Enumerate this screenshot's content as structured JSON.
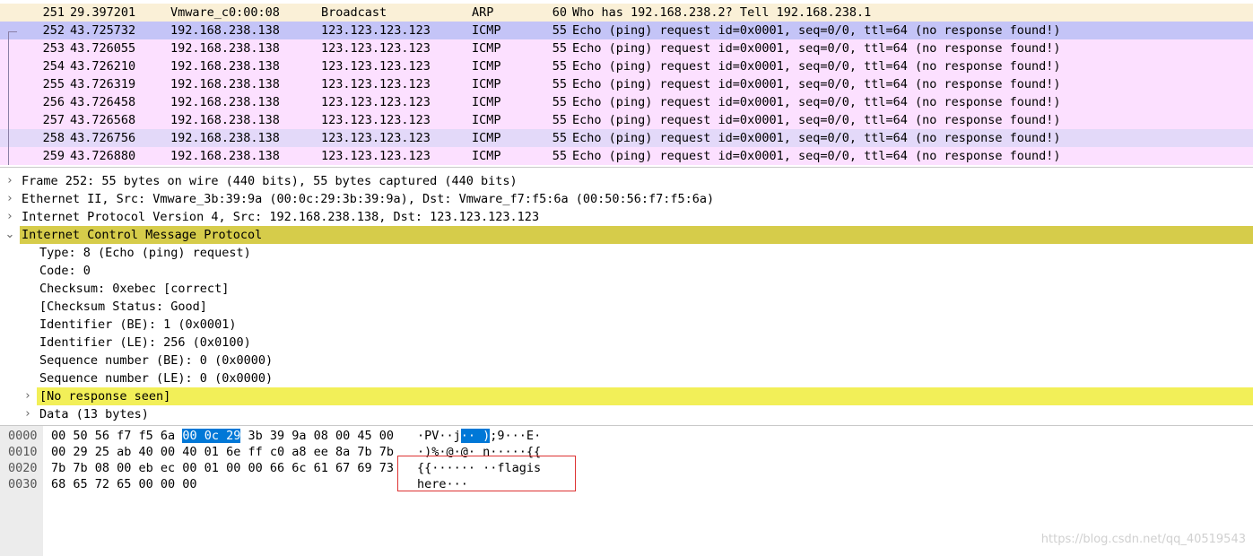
{
  "packets": [
    {
      "no": "251",
      "time": "29.397201",
      "src": "Vmware_c0:00:08",
      "dst": "Broadcast",
      "proto": "ARP",
      "len": "60",
      "info": "Who has 192.168.238.2? Tell 192.168.238.1"
    },
    {
      "no": "252",
      "time": "43.725732",
      "src": "192.168.238.138",
      "dst": "123.123.123.123",
      "proto": "ICMP",
      "len": "55",
      "info": "Echo (ping) request  id=0x0001, seq=0/0, ttl=64 (no response found!)"
    },
    {
      "no": "253",
      "time": "43.726055",
      "src": "192.168.238.138",
      "dst": "123.123.123.123",
      "proto": "ICMP",
      "len": "55",
      "info": "Echo (ping) request  id=0x0001, seq=0/0, ttl=64 (no response found!)"
    },
    {
      "no": "254",
      "time": "43.726210",
      "src": "192.168.238.138",
      "dst": "123.123.123.123",
      "proto": "ICMP",
      "len": "55",
      "info": "Echo (ping) request  id=0x0001, seq=0/0, ttl=64 (no response found!)"
    },
    {
      "no": "255",
      "time": "43.726319",
      "src": "192.168.238.138",
      "dst": "123.123.123.123",
      "proto": "ICMP",
      "len": "55",
      "info": "Echo (ping) request  id=0x0001, seq=0/0, ttl=64 (no response found!)"
    },
    {
      "no": "256",
      "time": "43.726458",
      "src": "192.168.238.138",
      "dst": "123.123.123.123",
      "proto": "ICMP",
      "len": "55",
      "info": "Echo (ping) request  id=0x0001, seq=0/0, ttl=64 (no response found!)"
    },
    {
      "no": "257",
      "time": "43.726568",
      "src": "192.168.238.138",
      "dst": "123.123.123.123",
      "proto": "ICMP",
      "len": "55",
      "info": "Echo (ping) request  id=0x0001, seq=0/0, ttl=64 (no response found!)"
    },
    {
      "no": "258",
      "time": "43.726756",
      "src": "192.168.238.138",
      "dst": "123.123.123.123",
      "proto": "ICMP",
      "len": "55",
      "info": "Echo (ping) request  id=0x0001, seq=0/0, ttl=64 (no response found!)"
    },
    {
      "no": "259",
      "time": "43.726880",
      "src": "192.168.238.138",
      "dst": "123.123.123.123",
      "proto": "ICMP",
      "len": "55",
      "info": "Echo (ping) request  id=0x0001, seq=0/0, ttl=64 (no response found!)"
    }
  ],
  "details": [
    {
      "text": "Frame 252: 55 bytes on wire (440 bits), 55 bytes captured (440 bits)",
      "twisty": ">"
    },
    {
      "text": "Ethernet II, Src: Vmware_3b:39:9a (00:0c:29:3b:39:9a), Dst: Vmware_f7:f5:6a (00:50:56:f7:f5:6a)",
      "twisty": ">"
    },
    {
      "text": "Internet Protocol Version 4, Src: 192.168.238.138, Dst: 123.123.123.123",
      "twisty": ">"
    },
    {
      "text": "Internet Control Message Protocol",
      "twisty": "v"
    },
    {
      "text": "Type: 8 (Echo (ping) request)"
    },
    {
      "text": "Code: 0"
    },
    {
      "text": "Checksum: 0xebec [correct]"
    },
    {
      "text": "[Checksum Status: Good]"
    },
    {
      "text": "Identifier (BE): 1 (0x0001)"
    },
    {
      "text": "Identifier (LE): 256 (0x0100)"
    },
    {
      "text": "Sequence number (BE): 0 (0x0000)"
    },
    {
      "text": "Sequence number (LE): 0 (0x0000)"
    },
    {
      "text": "[No response seen]",
      "twisty": ">"
    },
    {
      "text": "Data (13 bytes)",
      "twisty": ">"
    }
  ],
  "bytes": [
    {
      "offset": "0000",
      "hex_a": "00 50 56 f7 f5 6a ",
      "hex_sel": "00 0c  29",
      "hex_b": " 3b 39 9a 08 00 45 00",
      "ascii_a": "·PV··j",
      "ascii_sel": "·· )",
      "ascii_b": ";9···E·"
    },
    {
      "offset": "0010",
      "hex_a": "00 29 25 ab 40 00 40 01  6e ff c0 a8 ee 8a 7b 7b",
      "hex_sel": "",
      "hex_b": "",
      "ascii_a": "·)%·@·@· n·····{{",
      "ascii_sel": "",
      "ascii_b": ""
    },
    {
      "offset": "0020",
      "hex_a": "7b 7b 08 00 eb ec 00 01  00 00 66 6c 61 67 69 73",
      "hex_sel": "",
      "hex_b": "",
      "ascii_a": "{{······ ··flagis",
      "ascii_sel": "",
      "ascii_b": ""
    },
    {
      "offset": "0030",
      "hex_a": "68 65 72 65 00 00 00",
      "hex_sel": "",
      "hex_b": "",
      "ascii_a": "here···",
      "ascii_sel": "",
      "ascii_b": ""
    }
  ],
  "colors": {
    "arp_row": "#faf0d7",
    "icmp_row": "#fce0ff",
    "selected_row": "#c4c4f7",
    "hover_row": "#e3d9f9",
    "icmp_header": "#d6cc4a",
    "no_response": "#f2ef58",
    "byte_selection": "#0078d7",
    "annotation_box": "#dd3333"
  },
  "watermark": "https://blog.csdn.net/qq_40519543"
}
